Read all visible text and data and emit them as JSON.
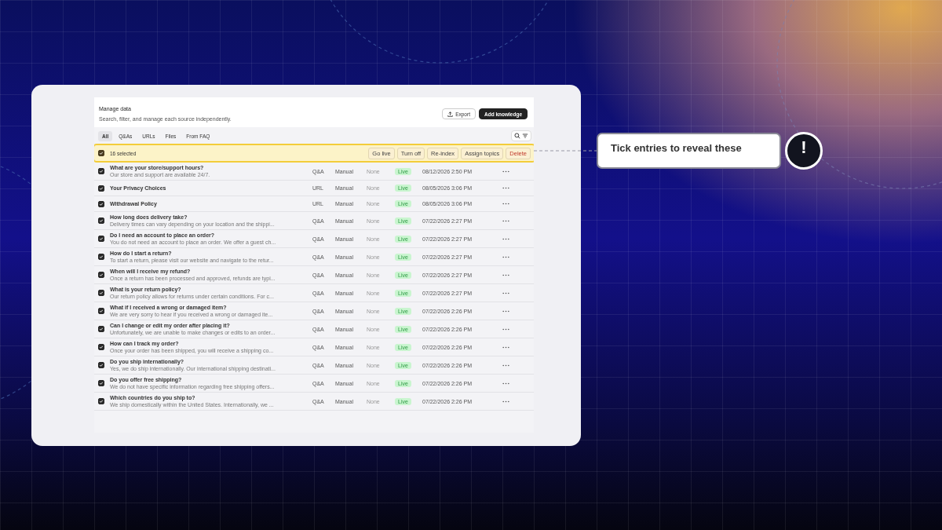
{
  "header": {
    "title": "Manage data",
    "subtitle": "Search, filter, and manage each source independently.",
    "export_button": "Export",
    "add_button": "Add knowledge"
  },
  "tabs": [
    {
      "label": "All",
      "selected": true
    },
    {
      "label": "Q&As",
      "selected": false
    },
    {
      "label": "URLs",
      "selected": false
    },
    {
      "label": "Files",
      "selected": false
    },
    {
      "label": "From FAQ",
      "selected": false
    }
  ],
  "selection": {
    "checked": true,
    "count": "16 selected",
    "actions": [
      {
        "label": "Go live",
        "kind": "normal"
      },
      {
        "label": "Turn off",
        "kind": "normal"
      },
      {
        "label": "Re-index",
        "kind": "normal"
      },
      {
        "label": "Assign topics",
        "kind": "normal"
      },
      {
        "label": "Delete",
        "kind": "danger"
      }
    ]
  },
  "rows": [
    {
      "checked": true,
      "title": "What are your store/support hours?",
      "excerpt": "Our store and support are available 24/7.",
      "type": "Q&A",
      "method": "Manual",
      "topics": "None",
      "status": "Live",
      "date": "08/12/2026 2:50 PM"
    },
    {
      "checked": true,
      "title": "Your Privacy Choices",
      "type": "URL",
      "method": "Manual",
      "topics": "None",
      "status": "Live",
      "date": "08/05/2026 3:06 PM"
    },
    {
      "checked": true,
      "title": "Withdrawal Policy",
      "type": "URL",
      "method": "Manual",
      "topics": "None",
      "status": "Live",
      "date": "08/05/2026 3:06 PM"
    },
    {
      "checked": true,
      "title": "How long does delivery take?",
      "excerpt": "Delivery times can vary depending on your location and the shippi...",
      "type": "Q&A",
      "method": "Manual",
      "topics": "None",
      "status": "Live",
      "date": "07/22/2026 2:27 PM"
    },
    {
      "checked": true,
      "title": "Do I need an account to place an order?",
      "excerpt": "You do not need an account to place an order. We offer a guest ch...",
      "type": "Q&A",
      "method": "Manual",
      "topics": "None",
      "status": "Live",
      "date": "07/22/2026 2:27 PM"
    },
    {
      "checked": true,
      "title": "How do I start a return?",
      "excerpt": "To start a return, please visit our website and navigate to the retur...",
      "type": "Q&A",
      "method": "Manual",
      "topics": "None",
      "status": "Live",
      "date": "07/22/2026 2:27 PM"
    },
    {
      "checked": true,
      "title": "When will I receive my refund?",
      "excerpt": "Once a return has been processed and approved, refunds are typi...",
      "type": "Q&A",
      "method": "Manual",
      "topics": "None",
      "status": "Live",
      "date": "07/22/2026 2:27 PM"
    },
    {
      "checked": true,
      "title": "What is your return policy?",
      "excerpt": "Our return policy allows for returns under certain conditions. For c...",
      "type": "Q&A",
      "method": "Manual",
      "topics": "None",
      "status": "Live",
      "date": "07/22/2026 2:27 PM"
    },
    {
      "checked": true,
      "title": "What if I received a wrong or damaged item?",
      "excerpt": "We are very sorry to hear if you received a wrong or damaged ite...",
      "type": "Q&A",
      "method": "Manual",
      "topics": "None",
      "status": "Live",
      "date": "07/22/2026 2:26 PM"
    },
    {
      "checked": true,
      "title": "Can I change or edit my order after placing it?",
      "excerpt": "Unfortunately, we are unable to make changes or edits to an order...",
      "type": "Q&A",
      "method": "Manual",
      "topics": "None",
      "status": "Live",
      "date": "07/22/2026 2:26 PM"
    },
    {
      "checked": true,
      "title": "How can I track my order?",
      "excerpt": "Once your order has been shipped, you will receive a shipping co...",
      "type": "Q&A",
      "method": "Manual",
      "topics": "None",
      "status": "Live",
      "date": "07/22/2026 2:26 PM"
    },
    {
      "checked": true,
      "title": "Do you ship internationally?",
      "excerpt": "Yes, we do ship internationally. Our international shipping destinati...",
      "type": "Q&A",
      "method": "Manual",
      "topics": "None",
      "status": "Live",
      "date": "07/22/2026 2:26 PM"
    },
    {
      "checked": true,
      "title": "Do you offer free shipping?",
      "excerpt": "We do not have specific information regarding free shipping offers...",
      "type": "Q&A",
      "method": "Manual",
      "topics": "None",
      "status": "Live",
      "date": "07/22/2026 2:26 PM"
    },
    {
      "checked": true,
      "title": "Which countries do you ship to?",
      "excerpt": "We ship domestically within the United States. Internationally, we ...",
      "type": "Q&A",
      "method": "Manual",
      "topics": "None",
      "status": "Live",
      "date": "07/22/2026 2:26 PM"
    }
  ],
  "callout": {
    "text": "Tick entries to reveal these",
    "badge": "!"
  }
}
